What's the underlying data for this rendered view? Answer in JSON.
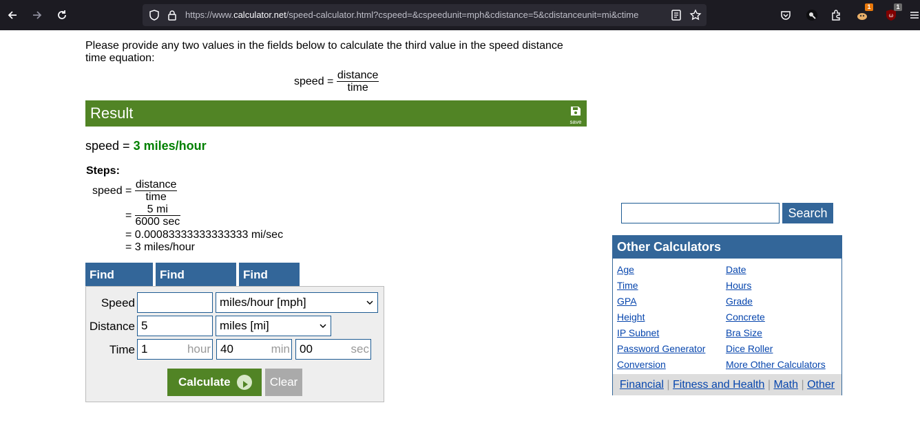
{
  "browser": {
    "url_prefix": "https://www.",
    "url_host": "calculator.net",
    "url_rest": "/speed-calculator.html?cspeed=&cspeedunit=mph&cdistance=5&cdistanceunit=mi&ctime",
    "ext_badge_1": "1",
    "ext_badge_2": "1"
  },
  "intro": {
    "text": "Please provide any two values in the fields below to calculate the third value in the speed distance time equation:",
    "formula_lhs": "speed =",
    "formula_num": "distance",
    "formula_den": "time"
  },
  "result": {
    "title": "Result",
    "save_label": "save",
    "label": "speed = ",
    "value": "3 miles/hour"
  },
  "steps": {
    "title": "Steps:",
    "lhs": "speed =",
    "frac1_num": "distance",
    "frac1_den": "time",
    "eq": "=",
    "frac2_num": "5 mi",
    "frac2_den": "6000 sec",
    "line3": "= 0.00083333333333333 mi/sec",
    "line4": "= 3 miles/hour"
  },
  "calculator": {
    "tabs": [
      "Find Speed",
      "Find Distance",
      "Find Time"
    ],
    "speed_label": "Speed",
    "speed_value": "",
    "speed_unit": "miles/hour [mph]",
    "distance_label": "Distance",
    "distance_value": "5",
    "distance_unit": "miles [mi]",
    "time_label": "Time",
    "hours_value": "1",
    "hours_unit": "hour",
    "minutes_value": "40",
    "minutes_unit": "min",
    "seconds_value": "00",
    "seconds_unit": "sec",
    "calculate_label": "Calculate",
    "clear_label": "Clear"
  },
  "sidebar": {
    "search_label": "Search",
    "other_title": "Other Calculators",
    "left_links": [
      "Age",
      "Time",
      "GPA",
      "Height",
      "IP Subnet",
      "Password Generator",
      "Conversion"
    ],
    "right_links": [
      "Date",
      "Hours",
      "Grade",
      "Concrete",
      "Bra Size",
      "Dice Roller",
      "More Other Calculators"
    ],
    "footer_links": [
      "Financial",
      "Fitness and Health",
      "Math",
      "Other"
    ]
  },
  "colors": {
    "result_green": "#518425",
    "tab_blue": "#336699",
    "link_blue": "#0645ad",
    "answer_green": "#008000"
  }
}
